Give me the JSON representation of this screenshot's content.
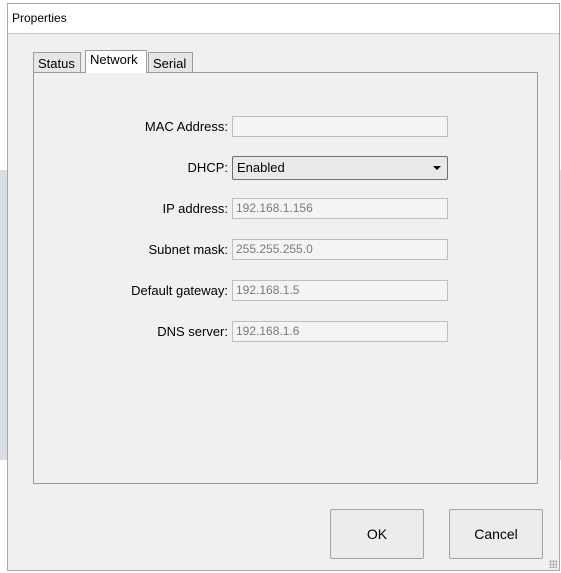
{
  "window": {
    "title": "Properties"
  },
  "tabs": [
    {
      "label": "Status",
      "active": false
    },
    {
      "label": "Network",
      "active": true
    },
    {
      "label": "Serial",
      "active": false
    }
  ],
  "form": {
    "mac_address": {
      "label": "MAC Address:",
      "value": ""
    },
    "dhcp": {
      "label": "DHCP:",
      "value": "Enabled"
    },
    "ip_address": {
      "label": "IP address:",
      "value": "192.168.1.156"
    },
    "subnet_mask": {
      "label": "Subnet mask:",
      "value": "255.255.255.0"
    },
    "default_gateway": {
      "label": "Default gateway:",
      "value": "192.168.1.5"
    },
    "dns_server": {
      "label": "DNS server:",
      "value": "192.168.1.6"
    }
  },
  "buttons": {
    "ok": "OK",
    "cancel": "Cancel"
  },
  "icons": {
    "dropdown": "chevron-down-icon",
    "resize": "resize-grip-icon"
  }
}
